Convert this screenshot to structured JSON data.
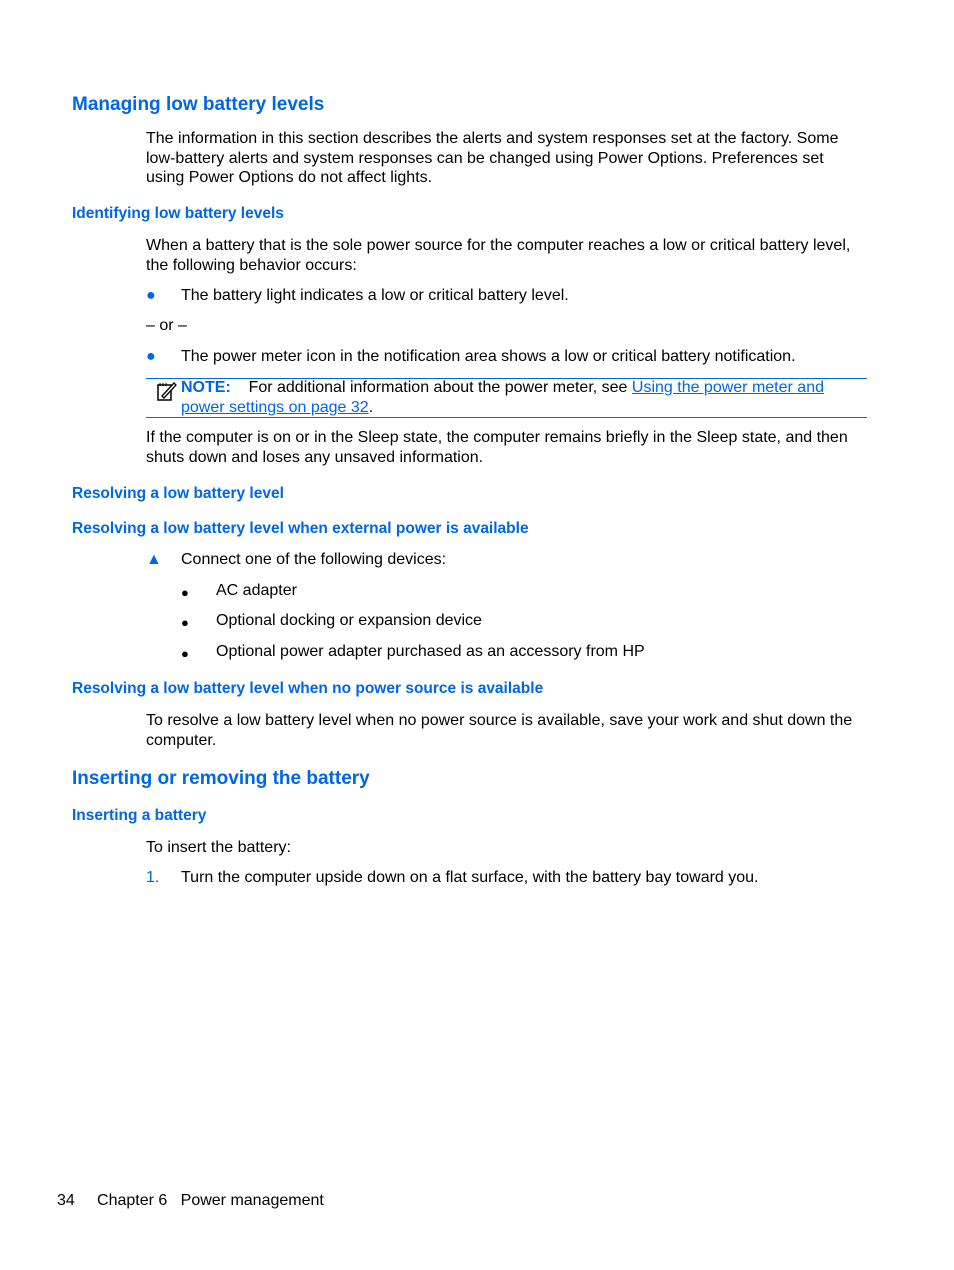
{
  "sections": {
    "h_managing": "Managing low battery levels",
    "p_managing": "The information in this section describes the alerts and system responses set at the factory. Some low-battery alerts and system responses can be changed using Power Options. Preferences set using Power Options do not affect lights.",
    "h_identifying": "Identifying low battery levels",
    "p_identifying": "When a battery that is the sole power source for the computer reaches a low or critical battery level, the following behavior occurs:",
    "bullet1": "The battery light indicates a low or critical battery level.",
    "or": "– or –",
    "bullet2": "The power meter icon in the notification area shows a low or critical battery notification.",
    "note_label": "NOTE:",
    "note_text": "For additional information about the power meter, see ",
    "note_link": "Using the power meter and power settings on page 32",
    "note_end": ".",
    "p_sleep": "If the computer is on or in the Sleep state, the computer remains briefly in the Sleep state, and then shuts down and loses any unsaved information.",
    "h_resolving": "Resolving a low battery level",
    "h_resolving_ext": "Resolving a low battery level when external power is available",
    "step_connect": "Connect one of the following devices:",
    "devices": [
      "AC adapter",
      "Optional docking or expansion device",
      "Optional power adapter purchased as an accessory from HP"
    ],
    "h_resolving_none": "Resolving a low battery level when no power source is available",
    "p_resolving_none": "To resolve a low battery level when no power source is available, save your work and shut down the computer.",
    "h_inserting_removing": "Inserting or removing the battery",
    "h_inserting": "Inserting a battery",
    "p_insert": "To insert the battery:",
    "step1_num": "1.",
    "step1": "Turn the computer upside down on a flat surface, with the battery bay toward you."
  },
  "footer": {
    "page": "34",
    "chapter": "Chapter 6",
    "title": "Power management"
  }
}
